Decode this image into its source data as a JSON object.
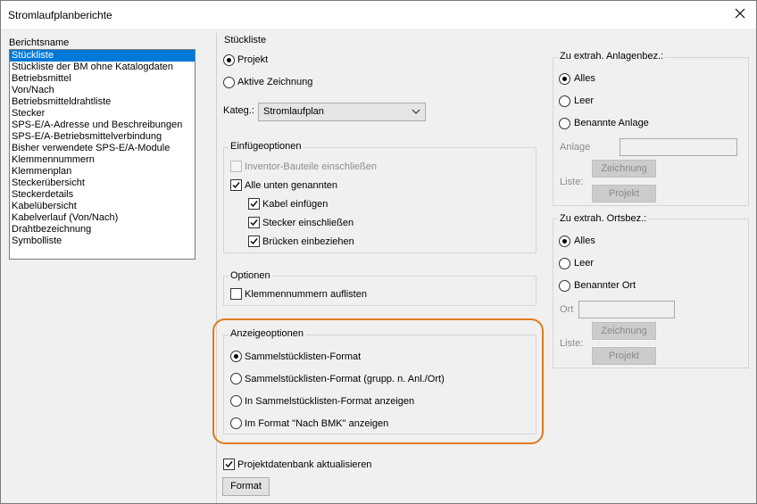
{
  "window": {
    "title": "Stromlaufplanberichte"
  },
  "report_list": {
    "label": "Berichtsname",
    "items": [
      "Stückliste",
      "Stückliste der BM ohne Katalogdaten",
      "Betriebsmittel",
      "Von/Nach",
      "Betriebsmitteldrahtliste",
      "Stecker",
      "SPS-E/A-Adresse und Beschreibungen",
      "SPS-E/A-Betriebsmittelverbindung",
      "Bisher verwendete SPS-E/A-Module",
      "Klemmennummern",
      "Klemmenplan",
      "Steckerübersicht",
      "Steckerdetails",
      "Kabelübersicht",
      "Kabelverlauf (Von/Nach)",
      "Drahtbezeichnung",
      "Symbolliste"
    ],
    "selected_index": 0
  },
  "stueckliste": {
    "label": "Stückliste",
    "projekt": "Projekt",
    "aktive_zeichnung": "Aktive Zeichnung",
    "kateg_label": "Kateg.:",
    "kateg_value": "Stromlaufplan",
    "einfuege": {
      "label": "Einfügeoptionen",
      "inventor": "Inventor-Bauteile einschließen",
      "alle": "Alle unten genannten",
      "kabel": "Kabel einfügen",
      "stecker": "Stecker einschließen",
      "bruecken": "Brücken einbeziehen"
    },
    "optionen": {
      "label": "Optionen",
      "klemmen": "Klemmennummern auflisten"
    },
    "anzeige": {
      "label": "Anzeigeoptionen",
      "opt1": "Sammelstücklisten-Format",
      "opt2": "Sammelstücklisten-Format (grupp. n. Anl./Ort)",
      "opt3": "In Sammelstücklisten-Format anzeigen",
      "opt4": "Im Format \"Nach BMK\" anzeigen"
    },
    "projektdb": "Projektdatenbank aktualisieren",
    "format_button": "Format"
  },
  "anlage_group": {
    "label": "Zu extrah. Anlagenbez.:",
    "alles": "Alles",
    "leer": "Leer",
    "benannte": "Benannte Anlage",
    "field_label": "Anlage",
    "field_value": "",
    "liste_label": "Liste:",
    "zeichnung_btn": "Zeichnung",
    "projekt_btn": "Projekt"
  },
  "ort_group": {
    "label": "Zu extrah. Ortsbez.:",
    "alles": "Alles",
    "leer": "Leer",
    "benannter": "Benannter Ort",
    "field_label": "Ort",
    "field_value": "",
    "liste_label": "Liste:",
    "zeichnung_btn": "Zeichnung",
    "projekt_btn": "Projekt"
  },
  "colors": {
    "selection": "#0078d7",
    "highlight": "#e07b1f"
  }
}
